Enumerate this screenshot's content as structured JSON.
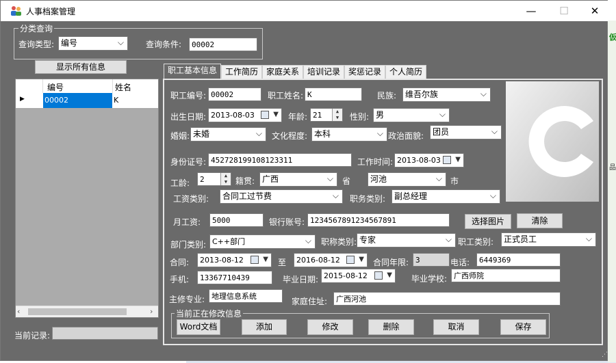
{
  "window": {
    "title": "人事档案管理",
    "minimize": "—",
    "maximize": "☐",
    "close": "✕"
  },
  "query": {
    "group_title": "分类查询",
    "type_label": "查询类型:",
    "type_value": "编号",
    "cond_label": "查询条件:",
    "cond_value": "00002"
  },
  "show_all_label": "显示所有信息",
  "grid": {
    "columns": [
      "编号",
      "姓名"
    ],
    "rows": [
      {
        "marker": "▶",
        "id": "00002",
        "name": "K"
      }
    ]
  },
  "current_record_label": "当前记录:",
  "tabs": [
    "职工基本信息",
    "工作简历",
    "家庭关系",
    "培训记录",
    "奖惩记录",
    "个人简历"
  ],
  "form": {
    "emp_no_label": "职工编号:",
    "emp_no": "00002",
    "emp_name_label": "职工姓名:",
    "emp_name": "K",
    "ethnic_label": "民族:",
    "ethnic": "维吾尔族",
    "birth_label": "出生日期:",
    "birth": "2013-08-03",
    "age_label": "年龄:",
    "age": "21",
    "gender_label": "性别:",
    "gender": "男",
    "marriage_label": "婚姻:",
    "marriage": "未婚",
    "edu_label": "文化程度:",
    "edu": "本科",
    "politic_label": "政治面貌:",
    "politic": "团员",
    "idcard_label": "身份证号:",
    "idcard": "452728199108123311",
    "work_time_label": "工作时间:",
    "work_time": "2013-08-03",
    "work_years_label": "工龄:",
    "work_years": "2",
    "native_label": "籍贯:",
    "native_province": "广西",
    "province_unit": "省",
    "native_city": "河池",
    "city_unit": "市",
    "salary_type_label": "工资类别:",
    "salary_type": "合同工过节费",
    "duty_type_label": "职务类别:",
    "duty_type": "副总经理",
    "monthly_salary_label": "月工资:",
    "monthly_salary": "5000",
    "bank_label": "银行账号:",
    "bank": "1234567891234567891",
    "choose_photo": "选择图片",
    "clear_photo": "清除",
    "dept_label": "部门类别:",
    "dept": "C++部门",
    "title_label": "职称类别:",
    "title": "专家",
    "emp_type_label": "职工类别:",
    "emp_type": "正式员工",
    "contract_label": "合同:",
    "contract_start": "2013-08-12",
    "to_label": "至",
    "contract_end": "2016-08-12",
    "contract_years_label": "合同年限:",
    "contract_years": "3",
    "phone_label": "电话:",
    "phone": "6449369",
    "mobile_label": "手机:",
    "mobile": "13367710439",
    "grad_date_label": "毕业日期:",
    "grad_date": "2015-08-12",
    "school_label": "毕业学校:",
    "school": "广西师院",
    "major_label": "主修专业:",
    "major": "地理信息系统",
    "address_label": "家庭住址:",
    "address": "广西河池"
  },
  "actions": {
    "group_title": "当前正在修改信息",
    "word": "Word文档",
    "add": "添加",
    "edit": "修改",
    "delete": "删除",
    "cancel": "取消",
    "save": "保存"
  },
  "background": {
    "right_text1": "仮",
    "right_text2": "品"
  },
  "colors": {
    "window_bg": "#6a6a6a",
    "selected_row": "#0078d7"
  }
}
